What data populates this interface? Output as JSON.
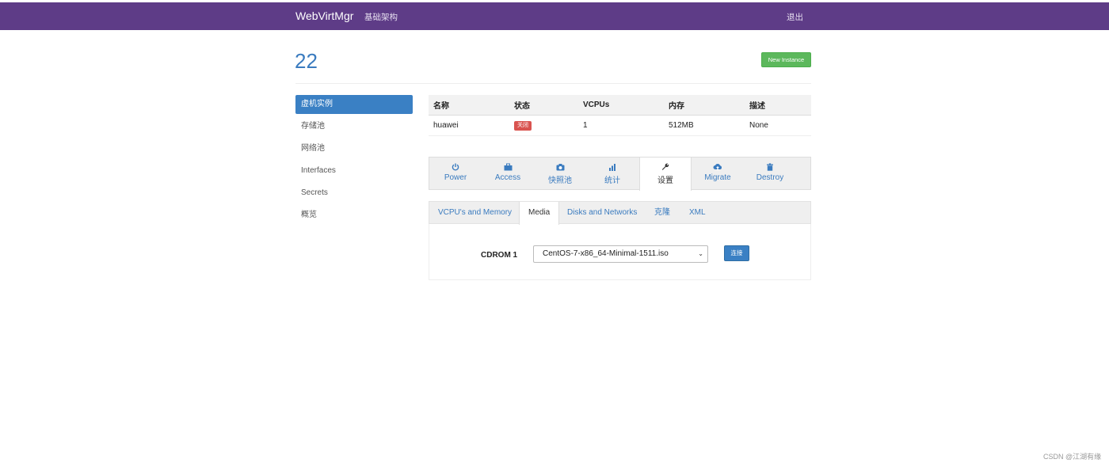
{
  "navbar": {
    "brand": "WebVirtMgr",
    "infrastructure": "基础架构",
    "logout": "退出"
  },
  "header": {
    "title": "22",
    "new_instance_label": "New Instance"
  },
  "sidebar": {
    "items": [
      {
        "label": "虚机实例"
      },
      {
        "label": "存储池"
      },
      {
        "label": "网络池"
      },
      {
        "label": "Interfaces"
      },
      {
        "label": "Secrets"
      },
      {
        "label": "概览"
      }
    ]
  },
  "instance_table": {
    "headers": [
      "名称",
      "状态",
      "VCPUs",
      "内存",
      "描述"
    ],
    "row": {
      "name": "huawei",
      "status": "关闭",
      "vcpus": "1",
      "memory": "512MB",
      "description": "None"
    }
  },
  "action_tabs": [
    {
      "label": "Power",
      "icon": "power-icon"
    },
    {
      "label": "Access",
      "icon": "briefcase-icon"
    },
    {
      "label": "快照池",
      "icon": "camera-icon"
    },
    {
      "label": "统计",
      "icon": "stats-icon"
    },
    {
      "label": "设置",
      "icon": "wrench-icon"
    },
    {
      "label": "Migrate",
      "icon": "cloud-upload-icon"
    },
    {
      "label": "Destroy",
      "icon": "trash-icon"
    }
  ],
  "settings_tabs": [
    {
      "label": "VCPU's and Memory"
    },
    {
      "label": "Media"
    },
    {
      "label": "Disks and Networks"
    },
    {
      "label": "克隆"
    },
    {
      "label": "XML"
    }
  ],
  "media": {
    "cdrom_label": "CDROM 1",
    "selected_iso": "CentOS-7-x86_64-Minimal-1511.iso",
    "connect_label": "连接"
  },
  "watermark": "CSDN @江湖有缘",
  "colors": {
    "navbar": "#5e3c87",
    "accent": "#3a80c4",
    "success": "#5cb85c",
    "danger": "#d9534f"
  }
}
